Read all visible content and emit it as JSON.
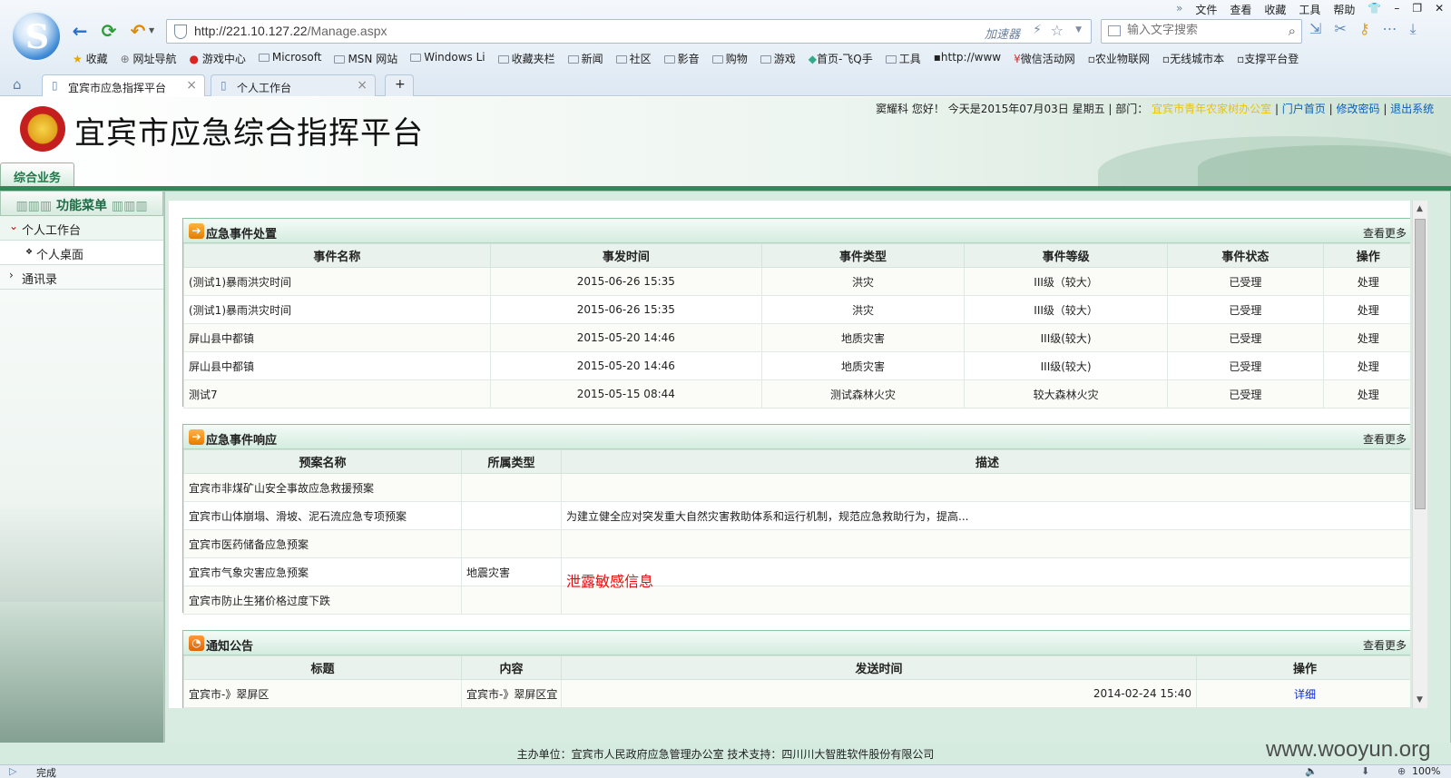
{
  "browser": {
    "menu": [
      "文件",
      "查看",
      "收藏",
      "工具",
      "帮助"
    ],
    "url_host": "http://221.10.127.22",
    "url_path": "/Manage.aspx",
    "accelerator": "加速器",
    "search_placeholder": "输入文字搜索",
    "bookmarks": [
      "收藏",
      "网址导航",
      "游戏中心",
      "Microsoft",
      "MSN 网站",
      "Windows Li",
      "收藏夹栏",
      "新闻",
      "社区",
      "影音",
      "购物",
      "游戏",
      "首页-飞Q手",
      "工具",
      "http://www",
      "微信活动网",
      "农业物联网",
      "无线城市本",
      "支撑平台登"
    ],
    "tabs": [
      "宜宾市应急指挥平台",
      "个人工作台"
    ],
    "status_text": "完成",
    "zoom": "100%"
  },
  "header": {
    "title": "宜宾市应急综合指挥平台",
    "user": "窦耀科",
    "greeting": "您好！",
    "date_text": "今天是2015年07月03日 星期五",
    "dept_label": "| 部门：",
    "dept_name": "宜宾市青年农家树办公室",
    "links": [
      "门户首页",
      "修改密码",
      "退出系统"
    ],
    "main_tab": "综合业务"
  },
  "sidebar": {
    "menu_title": "功能菜单",
    "items": [
      {
        "label": "个人工作台"
      },
      {
        "label": "个人桌面"
      },
      {
        "label": "通讯录"
      }
    ]
  },
  "panels": {
    "more": "查看更多",
    "events": {
      "title": "应急事件处置",
      "columns": [
        "事件名称",
        "事发时间",
        "事件类型",
        "事件等级",
        "事件状态",
        "操作"
      ],
      "rows": [
        [
          "(测试1)暴雨洪灾时间",
          "2015-06-26 15:35",
          "洪灾",
          "III级（较大）",
          "已受理",
          "处理"
        ],
        [
          "(测试1)暴雨洪灾时间",
          "2015-06-26 15:35",
          "洪灾",
          "III级（较大）",
          "已受理",
          "处理"
        ],
        [
          "屏山县中都镇",
          "2015-05-20 14:46",
          "地质灾害",
          "III级(较大)",
          "已受理",
          "处理"
        ],
        [
          "屏山县中都镇",
          "2015-05-20 14:46",
          "地质灾害",
          "III级(较大)",
          "已受理",
          "处理"
        ],
        [
          "测试7",
          "2015-05-15 08:44",
          "测试森林火灾",
          "较大森林火灾",
          "已受理",
          "处理"
        ]
      ]
    },
    "response": {
      "title": "应急事件响应",
      "columns": [
        "预案名称",
        "所属类型",
        "描述"
      ],
      "rows": [
        [
          "宜宾市非煤矿山安全事故应急救援预案",
          "",
          ""
        ],
        [
          "宜宾市山体崩塌、滑坡、泥石流应急专项预案",
          "",
          "为建立健全应对突发重大自然灾害救助体系和运行机制，规范应急救助行为，提高..."
        ],
        [
          "宜宾市医药储备应急预案",
          "",
          ""
        ],
        [
          "宜宾市气象灾害应急预案",
          "地震灾害",
          ""
        ],
        [
          "宜宾市防止生猪价格过度下跌",
          "",
          ""
        ]
      ],
      "annotation": "泄露敏感信息"
    },
    "notices": {
      "title": "通知公告",
      "columns": [
        "标题",
        "内容",
        "发送时间",
        "操作"
      ],
      "rows": [
        [
          "宜宾市-》翠屏区",
          "宜宾市-》翠屏区宜",
          "2014-02-24 15:40",
          "详细"
        ]
      ]
    }
  },
  "footer": {
    "text": "主办单位：宜宾市人民政府应急管理办公室 技术支持：四川川大智胜软件股份有限公司",
    "watermark": "www.wooyun.org"
  }
}
